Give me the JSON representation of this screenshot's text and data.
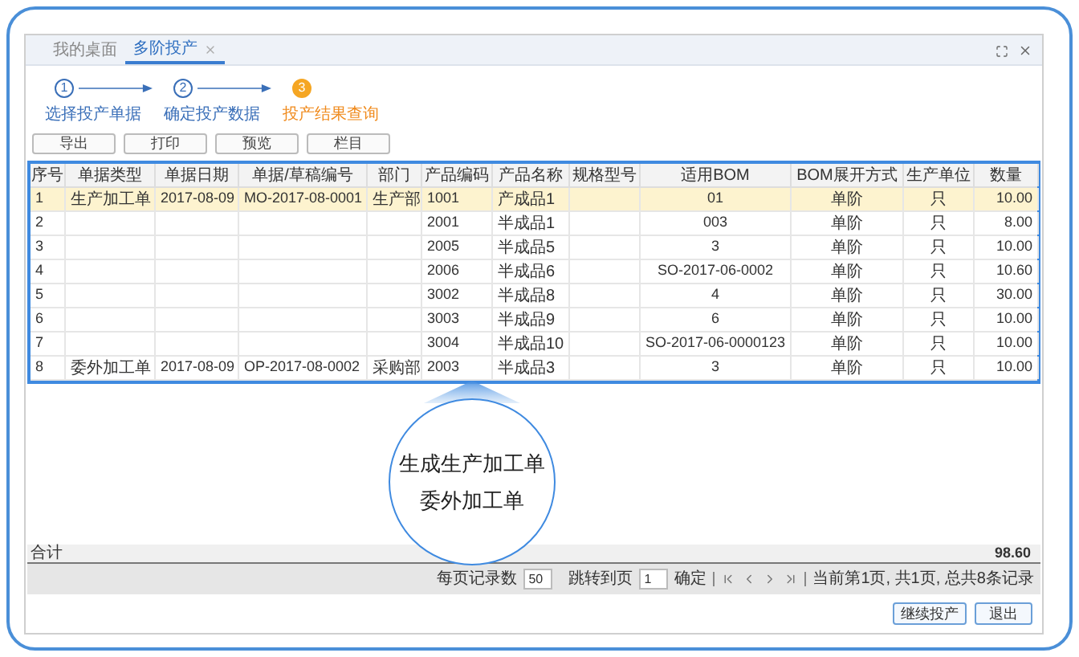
{
  "tabs": [
    {
      "label": "我的桌面",
      "selected": false,
      "closable": false
    },
    {
      "label": "多阶投产",
      "selected": true,
      "closable": true
    }
  ],
  "steps": [
    {
      "number": "1",
      "label": "选择投产单据",
      "selected": false
    },
    {
      "number": "2",
      "label": "确定投产数据",
      "selected": false
    },
    {
      "number": "3",
      "label": "投产结果查询",
      "selected": true
    }
  ],
  "toolbar": [
    "导出",
    "打印",
    "预览",
    "栏目"
  ],
  "table": {
    "columns": [
      "序号",
      "单据类型",
      "单据日期",
      "单据/草稿编号",
      "部门",
      "产品编码",
      "产品名称",
      "规格型号",
      "适用BOM",
      "BOM展开方式",
      "生产单位",
      "数量"
    ],
    "rows": [
      {
        "selected": true,
        "cells": [
          "1",
          "生产加工单",
          "2017-08-09",
          "MO-2017-08-0001",
          "生产部",
          "1001",
          "产成品1",
          null,
          "01",
          "单阶",
          "只",
          "10.00"
        ]
      },
      {
        "selected": false,
        "cells": [
          "2",
          null,
          null,
          null,
          null,
          "2001",
          "半成品1",
          null,
          "003",
          "单阶",
          "只",
          "8.00"
        ]
      },
      {
        "selected": false,
        "cells": [
          "3",
          null,
          null,
          null,
          null,
          "2005",
          "半成品5",
          null,
          "3",
          "单阶",
          "只",
          "10.00"
        ]
      },
      {
        "selected": false,
        "cells": [
          "4",
          null,
          null,
          null,
          null,
          "2006",
          "半成品6",
          null,
          "SO-2017-06-0002",
          "单阶",
          "只",
          "10.60"
        ]
      },
      {
        "selected": false,
        "cells": [
          "5",
          null,
          null,
          null,
          null,
          "3002",
          "半成品8",
          null,
          "4",
          "单阶",
          "只",
          "30.00"
        ]
      },
      {
        "selected": false,
        "cells": [
          "6",
          null,
          null,
          null,
          null,
          "3003",
          "半成品9",
          null,
          "6",
          "单阶",
          "只",
          "10.00"
        ]
      },
      {
        "selected": false,
        "cells": [
          "7",
          null,
          null,
          null,
          null,
          "3004",
          "半成品10",
          null,
          "SO-2017-06-0000123",
          "单阶",
          "只",
          "10.00"
        ]
      },
      {
        "selected": false,
        "cells": [
          "8",
          "委外加工单",
          "2017-08-09",
          "OP-2017-08-0002",
          "采购部",
          "2003",
          "半成品3",
          null,
          "3",
          "单阶",
          "只",
          "10.00"
        ]
      }
    ]
  },
  "total": {
    "label": "合计",
    "value": "98.60"
  },
  "pager": {
    "page_size_label": "每页记录数",
    "page_size": "50",
    "jump_label": "跳转到页",
    "page": "1",
    "confirm": "确定",
    "status": "当前第1页, 共1页, 总共8条记录"
  },
  "callout": {
    "lines": [
      "生成生产加工单",
      "委外加工单"
    ]
  },
  "buttons": [
    "继续投产",
    "退出"
  ]
}
